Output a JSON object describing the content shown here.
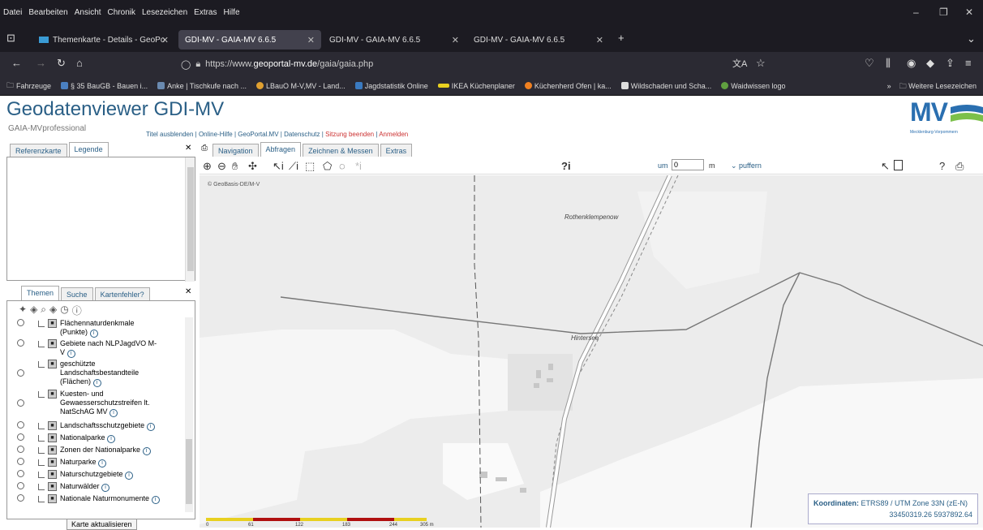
{
  "browser": {
    "menu": [
      "Datei",
      "Bearbeiten",
      "Ansicht",
      "Chronik",
      "Lesezeichen",
      "Extras",
      "Hilfe"
    ],
    "tabs": [
      "Themenkarte - Details - GeoPo",
      "GDI-MV - GAIA-MV 6.6.5",
      "GDI-MV - GAIA-MV 6.6.5",
      "GDI-MV - GAIA-MV 6.6.5"
    ],
    "url_prefix": "https://www.",
    "url_host": "geoportal-mv.de",
    "url_path": "/gaia/gaia.php",
    "bookmarks": [
      "Fahrzeuge",
      "§ 35 BauGB - Bauen i...",
      "Anke | Tischkufe nach ...",
      "LBauO M-V,MV - Land...",
      "Jagdstatistik Online",
      "IKEA Küchenplaner",
      "Küchenherd Ofen | ka...",
      "Wildschaden und Scha...",
      "Waidwissen logo"
    ],
    "bookmarks_more": "Weitere Lesezeichen"
  },
  "header": {
    "title": "Geodatenviewer GDI-MV",
    "subtitle": "GAIA-MVprofessional",
    "links": [
      "Titel ausblenden",
      "Online-Hilfe",
      "GeoPortal.MV",
      "Datenschutz"
    ],
    "links_red": [
      "Sitzung beenden",
      "Anmelden"
    ],
    "logo": "MV",
    "logo_sub": "Mecklenburg-Vorpommern"
  },
  "left": {
    "tabs_top": [
      "Referenzkarte",
      "Legende"
    ],
    "tabs_bottom": [
      "Themen",
      "Suche",
      "Kartenfehler?"
    ],
    "layers": [
      "Flächennaturdenkmale (Punkte)",
      "Gebiete nach NLPJagdVO M-V",
      "geschützte Landschaftsbestandteile (Flächen)",
      "Kuesten- und Gewaesserschutzstreifen lt. NatSchAG MV",
      "Landschaftsschutzgebiete",
      "Nationalparke",
      "Zonen der Nationalparke",
      "Naturparke",
      "Naturschutzgebiete",
      "Naturwälder",
      "Nationale Naturmonumente"
    ],
    "refresh": "Karte aktualisieren"
  },
  "map": {
    "tabs": [
      "Navigation",
      "Abfragen",
      "Zeichnen & Messen",
      "Extras"
    ],
    "active_tab": "Abfragen",
    "um_label": "um",
    "um_value": "0",
    "unit": "m",
    "puffern": "puffern",
    "copyright": "© GeoBasis-DE/M-V",
    "places": [
      "Rothenklempenow",
      "Hintersee"
    ],
    "coords_label": "Koordinaten:",
    "coords_system": "ETRS89 / UTM Zone 33N (zE-N)",
    "coords_value": "33450319.26 5937892.64",
    "scale_ticks": [
      "0",
      "61",
      "122",
      "183",
      "244",
      "305 m"
    ],
    "colors": {
      "water": "#ececec",
      "road": "#888"
    }
  }
}
